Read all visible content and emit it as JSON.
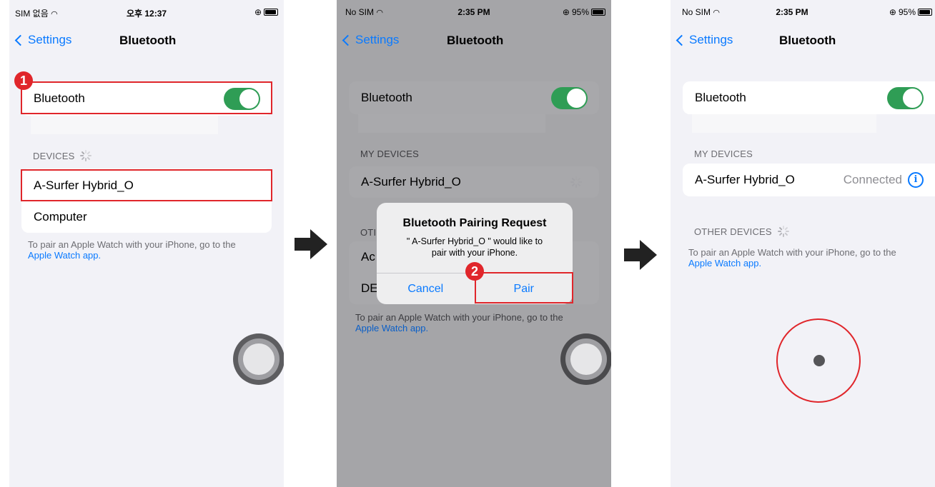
{
  "screens": [
    {
      "status": {
        "carrier": "SIM 없음",
        "time": "오후 12:37",
        "battery_text": ""
      },
      "nav": {
        "back_label": "Settings",
        "title": "Bluetooth"
      },
      "bluetooth_label": "Bluetooth",
      "section_header": "DEVICES",
      "devices": [
        "A-Surfer Hybrid_O",
        "Computer"
      ],
      "footer_text": "To pair an Apple Watch with your iPhone, go to the",
      "footer_link": "Apple Watch app.",
      "step": "1"
    },
    {
      "status": {
        "carrier": "No SIM",
        "time": "2:35 PM",
        "battery_text": "95%"
      },
      "nav": {
        "back_label": "Settings",
        "title": "Bluetooth"
      },
      "bluetooth_label": "Bluetooth",
      "section_header": "MY DEVICES",
      "my_device": "A-Surfer Hybrid_O",
      "other_header_partial": "OTI",
      "partial_rows": [
        "Ac",
        "DE"
      ],
      "footer_text": "To pair an Apple Watch with your iPhone, go to the",
      "footer_link": "Apple Watch app.",
      "dialog": {
        "title": "Bluetooth Pairing Request",
        "message": "\" A-Surfer Hybrid_O \" would like to pair with your iPhone.",
        "cancel": "Cancel",
        "pair": "Pair"
      },
      "step": "2"
    },
    {
      "status": {
        "carrier": "No SIM",
        "time": "2:35 PM",
        "battery_text": "95%"
      },
      "nav": {
        "back_label": "Settings",
        "title": "Bluetooth"
      },
      "bluetooth_label": "Bluetooth",
      "section_header": "MY DEVICES",
      "my_device": "A-Surfer Hybrid_O",
      "device_status": "Connected",
      "other_header": "OTHER DEVICES",
      "footer_text": "To pair an Apple Watch with your iPhone, go to the",
      "footer_link": "Apple Watch app."
    }
  ],
  "colors": {
    "accent": "#0a7aff",
    "toggle_on": "#2f9d55",
    "highlight": "#e0262b",
    "background": "#f2f2f7",
    "dim_overlay": "#a5a5a8"
  },
  "icons": [
    "chevron-left-icon",
    "wifi-icon",
    "battery-icon",
    "spinner-icon",
    "info-icon",
    "arrow-right-icon",
    "assistive-touch-icon"
  ]
}
